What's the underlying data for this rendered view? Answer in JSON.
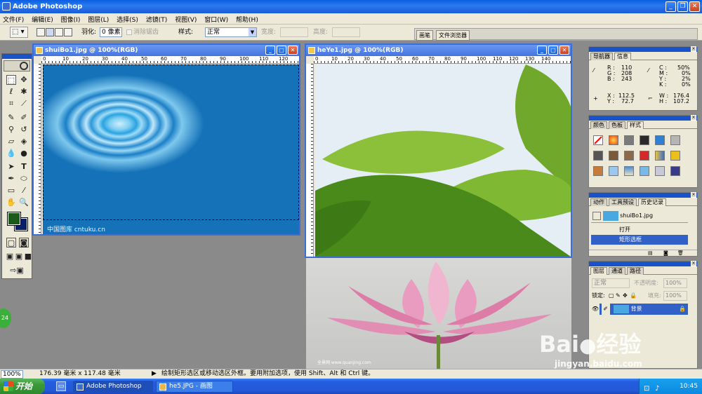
{
  "app": {
    "title": "Adobe Photoshop"
  },
  "menu": [
    "文件(F)",
    "编辑(E)",
    "图像(I)",
    "图层(L)",
    "选择(S)",
    "滤镜(T)",
    "视图(V)",
    "窗口(W)",
    "帮助(H)"
  ],
  "options": {
    "feather_label": "羽化:",
    "feather_value": "0 像素",
    "antialias_label": "消除锯齿",
    "style_label": "样式:",
    "style_value": "正常",
    "width_label": "宽度:",
    "height_label": "高度:",
    "palette_well": [
      "画笔",
      "文件浏览器"
    ]
  },
  "doc1": {
    "title": "shuiBo1.jpg @ 100%(RGB)",
    "ruler": [
      "0",
      "10",
      "20",
      "30",
      "40",
      "50",
      "60",
      "70",
      "80",
      "90",
      "100",
      "110",
      "120",
      "130",
      "140",
      "150",
      "160"
    ],
    "watermark": "中国图库 cntuku.cn"
  },
  "doc2": {
    "title": "heYe1.jpg @ 100%(RGB)",
    "ruler": [
      "0",
      "10",
      "20",
      "30",
      "40",
      "50",
      "60",
      "70",
      "80",
      "90",
      "100",
      "110",
      "120",
      "130",
      "140",
      "150",
      "160"
    ],
    "watermark": "全景网 www.quanjing.com"
  },
  "navigator": {
    "tabs": [
      "导航器",
      "信息"
    ],
    "r_label": "R :",
    "r": "110",
    "g_label": "G :",
    "g": "208",
    "b_label": "B :",
    "b": "243",
    "c_label": "C :",
    "c": "50%",
    "m_label": "M :",
    "m": "0%",
    "y_label": "Y :",
    "y": "2%",
    "k_label": "K :",
    "k": "0%",
    "x_label": "X :",
    "x": "112.5",
    "yy_label": "Y :",
    "yy": "72.7",
    "w_label": "W :",
    "w": "176.4",
    "h_label": "H :",
    "h": "107.2"
  },
  "color_panel": {
    "tabs": [
      "颜色",
      "色板",
      "样式"
    ]
  },
  "history": {
    "tabs": [
      "动作",
      "工具预设",
      "历史记录"
    ],
    "snapshot": "shuiBo1.jpg",
    "steps": [
      "打开",
      "矩形选框"
    ]
  },
  "layers": {
    "tabs": [
      "图层",
      "通道",
      "路径"
    ],
    "blend": "正常",
    "opacity_label": "不透明度:",
    "opacity": "100%",
    "lock_label": "锁定:",
    "fill_label": "填充:",
    "fill": "100%",
    "layer_name": "背景"
  },
  "status": {
    "zoom": "100%",
    "size": "176.39 毫米 x 117.48 毫米",
    "hint": "绘制矩形选区或移动选区外框。要用附加选项，使用 Shift、Alt 和 Ctrl 键。"
  },
  "taskbar": {
    "start": "开始",
    "tasks": [
      "Adobe Photoshop",
      "he5.JPG - 画图"
    ],
    "clock": "10:45"
  },
  "overlay": {
    "baidu": "Bai",
    "baidu2": "经验",
    "baidu_url": "jingyan.baidu.com",
    "badge": "24"
  },
  "colors": {
    "foreground": "#1b5a1b",
    "background": "#0a1f6a",
    "accent": "#3160c6"
  }
}
